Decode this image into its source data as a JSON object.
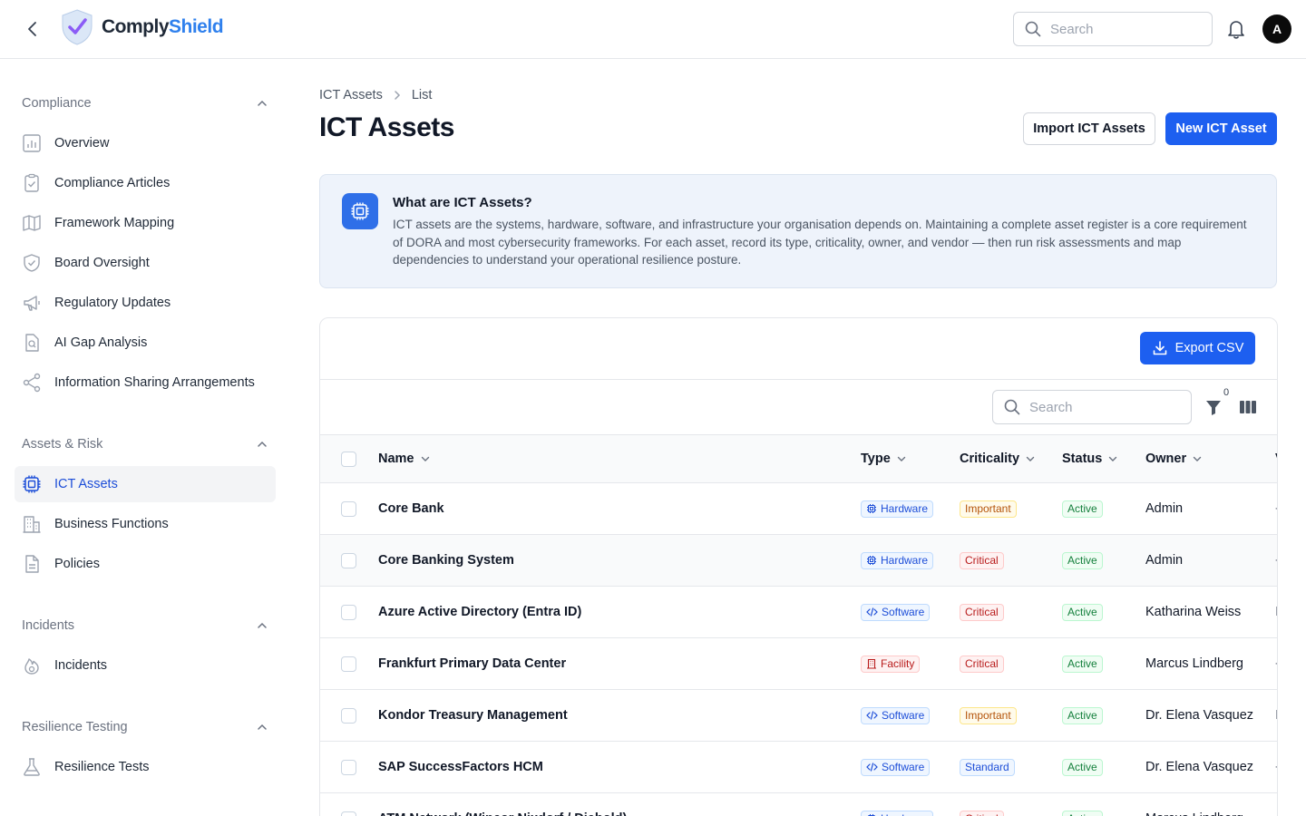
{
  "app": {
    "brand_a": "Comply",
    "brand_b": "Shield",
    "user_initial": "A"
  },
  "top_search": {
    "placeholder": "Search"
  },
  "sidebar": {
    "sections": [
      {
        "title": "Compliance",
        "items": [
          "Overview",
          "Compliance Articles",
          "Framework Mapping",
          "Board Oversight",
          "Regulatory Updates",
          "AI Gap Analysis",
          "Information Sharing Arrangements"
        ]
      },
      {
        "title": "Assets & Risk",
        "items": [
          "ICT Assets",
          "Business Functions",
          "Policies"
        ]
      },
      {
        "title": "Incidents",
        "items": [
          "Incidents"
        ]
      },
      {
        "title": "Resilience Testing",
        "items": [
          "Resilience Tests"
        ]
      }
    ],
    "active_item": "ICT Assets"
  },
  "breadcrumb": {
    "root": "ICT Assets",
    "current": "List"
  },
  "page": {
    "title": "ICT Assets",
    "import_label": "Import ICT Assets",
    "new_label": "New ICT Asset"
  },
  "info": {
    "title": "What are ICT Assets?",
    "body": "ICT assets are the systems, hardware, software, and infrastructure your organisation depends on. Maintaining a complete asset register is a core requirement of DORA and most cybersecurity frameworks. For each asset, record its type, criticality, owner, and vendor — then run risk assessments and map dependencies to understand your operational resilience posture."
  },
  "table": {
    "export_label": "Export CSV",
    "search_placeholder": "Search",
    "filter_count": "0",
    "columns": [
      "Name",
      "Type",
      "Criticality",
      "Status",
      "Owner",
      "V"
    ],
    "rows": [
      {
        "name": "Core Bank",
        "type": "Hardware",
        "criticality": "Important",
        "status": "Active",
        "owner": "Admin",
        "vendor": "-"
      },
      {
        "name": "Core Banking System",
        "type": "Hardware",
        "criticality": "Critical",
        "status": "Active",
        "owner": "Admin",
        "vendor": "-"
      },
      {
        "name": "Azure Active Directory (Entra ID)",
        "type": "Software",
        "criticality": "Critical",
        "status": "Active",
        "owner": "Katharina Weiss",
        "vendor": "I"
      },
      {
        "name": "Frankfurt Primary Data Center",
        "type": "Facility",
        "criticality": "Critical",
        "status": "Active",
        "owner": "Marcus Lindberg",
        "vendor": "-"
      },
      {
        "name": "Kondor Treasury Management",
        "type": "Software",
        "criticality": "Important",
        "status": "Active",
        "owner": "Dr. Elena Vasquez",
        "vendor": "I"
      },
      {
        "name": "SAP SuccessFactors HCM",
        "type": "Software",
        "criticality": "Standard",
        "status": "Active",
        "owner": "Dr. Elena Vasquez",
        "vendor": "-"
      },
      {
        "name": "ATM Network (Wincor Nixdorf / Diebold)",
        "type": "Hardware",
        "criticality": "Critical",
        "status": "Active",
        "owner": "Marcus Lindberg",
        "vendor": "-"
      }
    ]
  },
  "colors": {
    "primary": "#1d5ff0",
    "brand_accent": "#2f80ed",
    "active_nav": "#1d4ed8"
  }
}
